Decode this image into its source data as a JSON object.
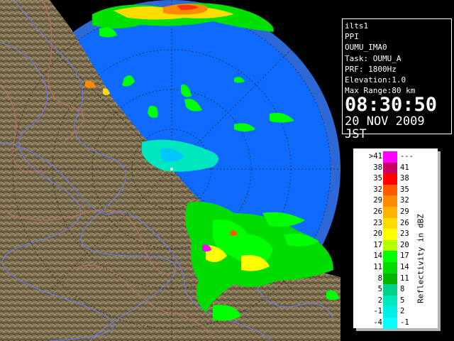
{
  "info": {
    "station": "ilts1",
    "product": "PPI",
    "site": "OUMU_IMA0",
    "task": "Task: OUMU_A",
    "prf": "PRF: 1800Hz",
    "elevation": "Elevation:1.0",
    "max_range": "Max Range:80 km",
    "time": "08:30:50",
    "date": "20 NOV 2009 JST"
  },
  "legend": {
    "unit": "Reflectivity in dBZ",
    "rows": [
      {
        "lo": ">41",
        "hi": "---",
        "color": "#ff00ff"
      },
      {
        "lo": "38",
        "hi": "41",
        "color": "#c80064"
      },
      {
        "lo": "35",
        "hi": "38",
        "color": "#ff0000"
      },
      {
        "lo": "32",
        "hi": "35",
        "color": "#ff5a00"
      },
      {
        "lo": "29",
        "hi": "32",
        "color": "#ff8c00"
      },
      {
        "lo": "26",
        "hi": "29",
        "color": "#ffb400"
      },
      {
        "lo": "23",
        "hi": "26",
        "color": "#ffdc00"
      },
      {
        "lo": "20",
        "hi": "23",
        "color": "#ffff00"
      },
      {
        "lo": "17",
        "hi": "20",
        "color": "#b4ff00"
      },
      {
        "lo": "14",
        "hi": "17",
        "color": "#00ff00"
      },
      {
        "lo": "11",
        "hi": "14",
        "color": "#00dc00"
      },
      {
        "lo": "8",
        "hi": "11",
        "color": "#00b400"
      },
      {
        "lo": "5",
        "hi": "8",
        "color": "#00d28c"
      },
      {
        "lo": "2",
        "hi": "5",
        "color": "#00e6be"
      },
      {
        "lo": "-1",
        "hi": "2",
        "color": "#00f0e6"
      },
      {
        "lo": "-4",
        "hi": "-1",
        "color": "#00ffff"
      }
    ]
  },
  "colors": {
    "sea": "#0f6bff",
    "outer_ring": "#2a63d8",
    "land": "#7a6a4a"
  }
}
